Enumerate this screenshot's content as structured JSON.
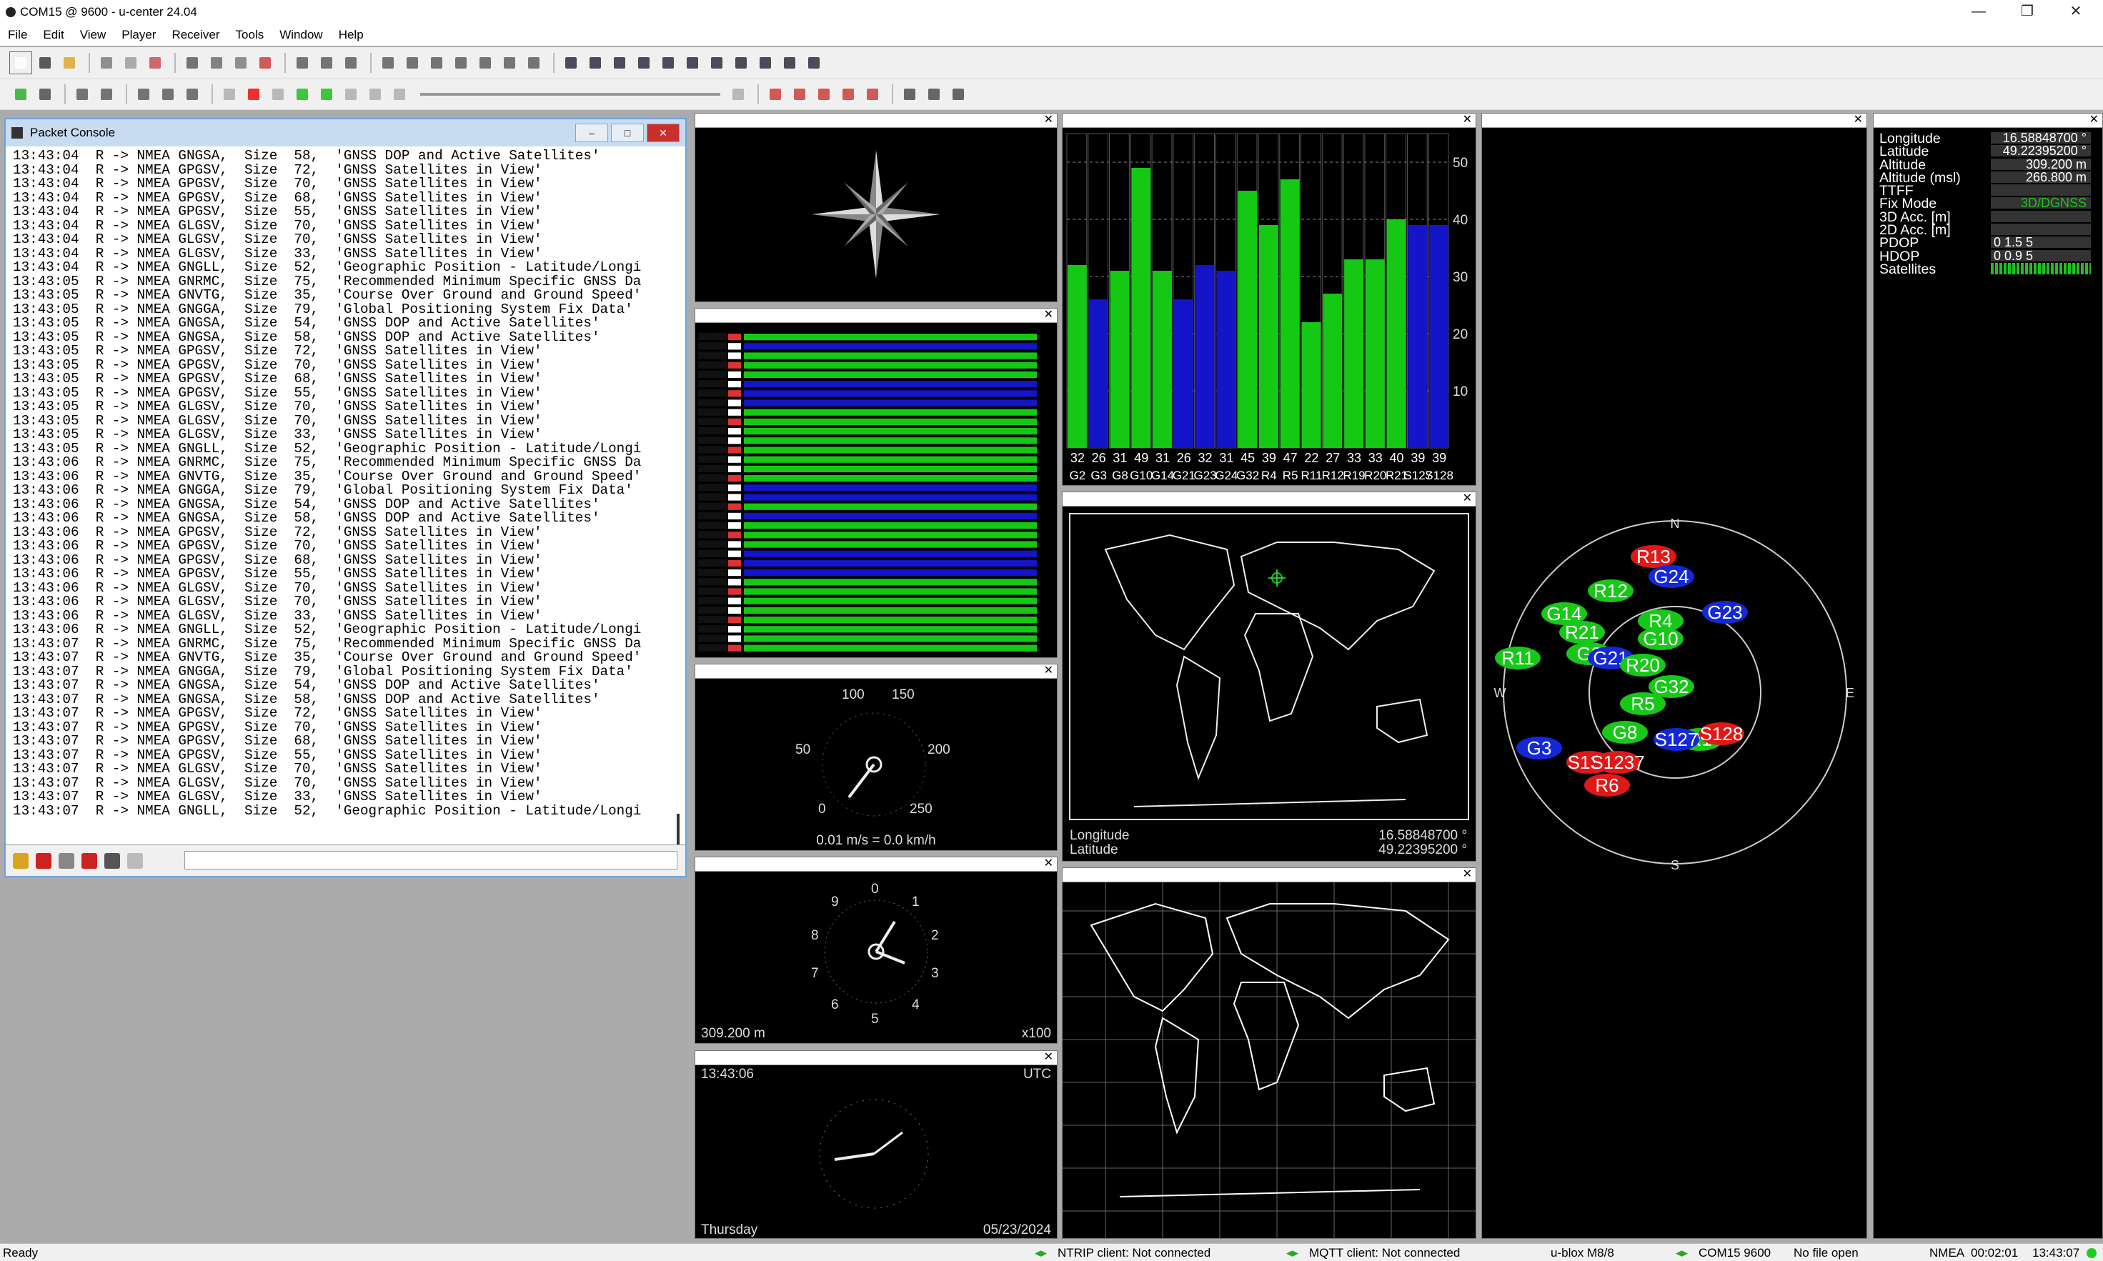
{
  "window": {
    "title": "COM15 @ 9600 - u-center 24.04",
    "min": "—",
    "restore": "❐",
    "close": "✕"
  },
  "menu": [
    "File",
    "Edit",
    "View",
    "Player",
    "Receiver",
    "Tools",
    "Window",
    "Help"
  ],
  "console": {
    "title": "Packet Console",
    "lines": [
      "13:43:04  R -> NMEA GNGSA,  Size  58,  'GNSS DOP and Active Satellites'",
      "13:43:04  R -> NMEA GPGSV,  Size  72,  'GNSS Satellites in View'",
      "13:43:04  R -> NMEA GPGSV,  Size  70,  'GNSS Satellites in View'",
      "13:43:04  R -> NMEA GPGSV,  Size  68,  'GNSS Satellites in View'",
      "13:43:04  R -> NMEA GPGSV,  Size  55,  'GNSS Satellites in View'",
      "13:43:04  R -> NMEA GLGSV,  Size  70,  'GNSS Satellites in View'",
      "13:43:04  R -> NMEA GLGSV,  Size  70,  'GNSS Satellites in View'",
      "13:43:04  R -> NMEA GLGSV,  Size  33,  'GNSS Satellites in View'",
      "13:43:04  R -> NMEA GNGLL,  Size  52,  'Geographic Position - Latitude/Longi",
      "13:43:05  R -> NMEA GNRMC,  Size  75,  'Recommended Minimum Specific GNSS Da",
      "13:43:05  R -> NMEA GNVTG,  Size  35,  'Course Over Ground and Ground Speed'",
      "13:43:05  R -> NMEA GNGGA,  Size  79,  'Global Positioning System Fix Data'",
      "13:43:05  R -> NMEA GNGSA,  Size  54,  'GNSS DOP and Active Satellites'",
      "13:43:05  R -> NMEA GNGSA,  Size  58,  'GNSS DOP and Active Satellites'",
      "13:43:05  R -> NMEA GPGSV,  Size  72,  'GNSS Satellites in View'",
      "13:43:05  R -> NMEA GPGSV,  Size  70,  'GNSS Satellites in View'",
      "13:43:05  R -> NMEA GPGSV,  Size  68,  'GNSS Satellites in View'",
      "13:43:05  R -> NMEA GPGSV,  Size  55,  'GNSS Satellites in View'",
      "13:43:05  R -> NMEA GLGSV,  Size  70,  'GNSS Satellites in View'",
      "13:43:05  R -> NMEA GLGSV,  Size  70,  'GNSS Satellites in View'",
      "13:43:05  R -> NMEA GLGSV,  Size  33,  'GNSS Satellites in View'",
      "13:43:05  R -> NMEA GNGLL,  Size  52,  'Geographic Position - Latitude/Longi",
      "13:43:06  R -> NMEA GNRMC,  Size  75,  'Recommended Minimum Specific GNSS Da",
      "13:43:06  R -> NMEA GNVTG,  Size  35,  'Course Over Ground and Ground Speed'",
      "13:43:06  R -> NMEA GNGGA,  Size  79,  'Global Positioning System Fix Data'",
      "13:43:06  R -> NMEA GNGSA,  Size  54,  'GNSS DOP and Active Satellites'",
      "13:43:06  R -> NMEA GNGSA,  Size  58,  'GNSS DOP and Active Satellites'",
      "13:43:06  R -> NMEA GPGSV,  Size  72,  'GNSS Satellites in View'",
      "13:43:06  R -> NMEA GPGSV,  Size  70,  'GNSS Satellites in View'",
      "13:43:06  R -> NMEA GPGSV,  Size  68,  'GNSS Satellites in View'",
      "13:43:06  R -> NMEA GPGSV,  Size  55,  'GNSS Satellites in View'",
      "13:43:06  R -> NMEA GLGSV,  Size  70,  'GNSS Satellites in View'",
      "13:43:06  R -> NMEA GLGSV,  Size  70,  'GNSS Satellites in View'",
      "13:43:06  R -> NMEA GLGSV,  Size  33,  'GNSS Satellites in View'",
      "13:43:06  R -> NMEA GNGLL,  Size  52,  'Geographic Position - Latitude/Longi",
      "13:43:07  R -> NMEA GNRMC,  Size  75,  'Recommended Minimum Specific GNSS Da",
      "13:43:07  R -> NMEA GNVTG,  Size  35,  'Course Over Ground and Ground Speed'",
      "13:43:07  R -> NMEA GNGGA,  Size  79,  'Global Positioning System Fix Data'",
      "13:43:07  R -> NMEA GNGSA,  Size  54,  'GNSS DOP and Active Satellites'",
      "13:43:07  R -> NMEA GNGSA,  Size  58,  'GNSS DOP and Active Satellites'",
      "13:43:07  R -> NMEA GPGSV,  Size  72,  'GNSS Satellites in View'",
      "13:43:07  R -> NMEA GPGSV,  Size  70,  'GNSS Satellites in View'",
      "13:43:07  R -> NMEA GPGSV,  Size  68,  'GNSS Satellites in View'",
      "13:43:07  R -> NMEA GPGSV,  Size  55,  'GNSS Satellites in View'",
      "13:43:07  R -> NMEA GLGSV,  Size  70,  'GNSS Satellites in View'",
      "13:43:07  R -> NMEA GLGSV,  Size  70,  'GNSS Satellites in View'",
      "13:43:07  R -> NMEA GLGSV,  Size  33,  'GNSS Satellites in View'",
      "13:43:07  R -> NMEA GNGLL,  Size  52,  'Geographic Position - Latitude/Longi"
    ]
  },
  "speedometer": {
    "ticks": [
      "100",
      "150",
      "50",
      "200",
      "0",
      "250"
    ],
    "readout": "0.01 m/s = 0.0 km/h"
  },
  "altimeter": {
    "ticks": [
      "0",
      "1",
      "2",
      "3",
      "4",
      "5",
      "6",
      "7",
      "8",
      "9"
    ],
    "readout": "309.200 m",
    "scale": "x100"
  },
  "clock": {
    "time": "13:43:06",
    "zone": "UTC",
    "day": "Thursday",
    "date": "05/23/2024"
  },
  "worldmap": {
    "lon_label": "Longitude",
    "lon": "16.58848700 °",
    "lat_label": "Latitude",
    "lat": "49.22395200 °"
  },
  "skyview": {
    "N": "N",
    "S": "S",
    "E": "E",
    "W": "W",
    "sats": [
      {
        "id": "R13",
        "c": "red"
      },
      {
        "id": "G24",
        "c": "blue"
      },
      {
        "id": "R12",
        "c": "green"
      },
      {
        "id": "G23",
        "c": "blue"
      },
      {
        "id": "G14",
        "c": "green"
      },
      {
        "id": "R4",
        "c": "green"
      },
      {
        "id": "R21",
        "c": "green"
      },
      {
        "id": "G10",
        "c": "green"
      },
      {
        "id": "R11",
        "c": "green"
      },
      {
        "id": "G2",
        "c": "green"
      },
      {
        "id": "G21",
        "c": "blue"
      },
      {
        "id": "R20",
        "c": "green"
      },
      {
        "id": "G32",
        "c": "green"
      },
      {
        "id": "R5",
        "c": "green"
      },
      {
        "id": "G8",
        "c": "green"
      },
      {
        "id": "R1",
        "c": "green"
      },
      {
        "id": "S128",
        "c": "red"
      },
      {
        "id": "G3",
        "c": "blue"
      },
      {
        "id": "S127",
        "c": "blue"
      },
      {
        "id": "S136",
        "c": "red"
      },
      {
        "id": "S1237",
        "c": "red"
      },
      {
        "id": "R6",
        "c": "red"
      }
    ]
  },
  "info": [
    {
      "k": "Longitude",
      "v": "16.58848700 °"
    },
    {
      "k": "Latitude",
      "v": "49.22395200 °"
    },
    {
      "k": "Altitude",
      "v": "309.200 m"
    },
    {
      "k": "Altitude (msl)",
      "v": "266.800 m"
    },
    {
      "k": "TTFF",
      "v": ""
    },
    {
      "k": "Fix Mode",
      "v": "3D/DGNSS"
    },
    {
      "k": "3D Acc. [m]",
      "v": ""
    },
    {
      "k": "2D Acc. [m]",
      "v": ""
    },
    {
      "k": "PDOP",
      "v": "0   1.5    5"
    },
    {
      "k": "HDOP",
      "v": "0  0.9     5"
    },
    {
      "k": "Satellites",
      "v": ""
    }
  ],
  "chart_data": {
    "type": "bar",
    "categories": [
      "G2",
      "G3",
      "G8",
      "G10",
      "G14",
      "G21",
      "G23",
      "G24",
      "G32",
      "R4",
      "R5",
      "R11",
      "R12",
      "R19",
      "R20",
      "R21",
      "S127",
      "S128"
    ],
    "series": [
      {
        "values": [
          32,
          26,
          31,
          49,
          31,
          26,
          32,
          31,
          45,
          39,
          47,
          22,
          27,
          33,
          33,
          40,
          39,
          39
        ]
      }
    ],
    "ylim": [
      0,
      55
    ],
    "yticks": [
      "10",
      "20",
      "30",
      "40",
      "50"
    ],
    "colors": [
      "#14c814",
      "#1414c8",
      "#14c814",
      "#14c814",
      "#14c814",
      "#1414c8",
      "#1414c8",
      "#1414c8",
      "#14c814",
      "#14c814",
      "#14c814",
      "#14c814",
      "#14c814",
      "#14c814",
      "#14c814",
      "#14c814",
      "#1414c8",
      "#1414c8"
    ]
  },
  "status": {
    "ready": "Ready",
    "ntrip": "NTRIP client: Not connected",
    "mqtt": "MQTT client: Not connected",
    "receiver": "u-blox M8/8",
    "port": "COM15 9600",
    "file": "No file open",
    "protocol": "NMEA",
    "elapsed": "00:02:01",
    "utc": "13:43:07"
  }
}
